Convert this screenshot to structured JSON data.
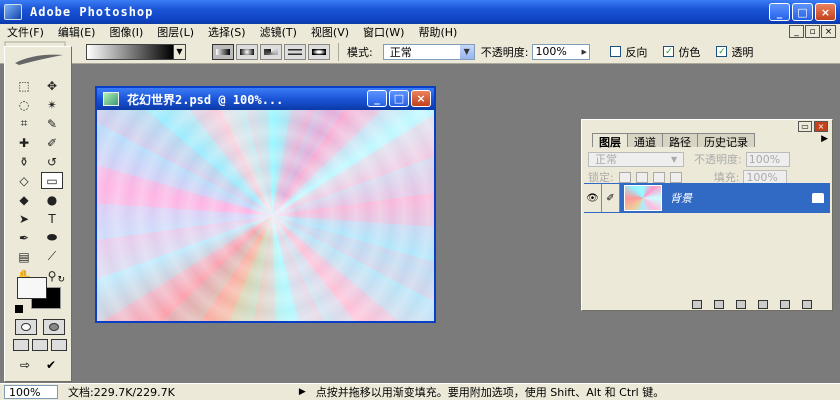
{
  "app": {
    "title": "Adobe Photoshop"
  },
  "window_buttons": {
    "minimize": "_",
    "maximize": "□",
    "close": "×"
  },
  "menu": [
    "文件(F)",
    "编辑(E)",
    "图像(I)",
    "图层(L)",
    "选择(S)",
    "滤镜(T)",
    "视图(V)",
    "窗口(W)",
    "帮助(H)"
  ],
  "options": {
    "mode_label": "模式:",
    "mode_value": "正常",
    "opacity_label": "不透明度:",
    "opacity_value": "100%",
    "reverse_label": "反向",
    "dither_label": "仿色",
    "transparency_label": "透明",
    "reverse_checked": false,
    "dither_checked": true,
    "transparency_checked": true
  },
  "document": {
    "title": "花幻世界2.psd @ 100%..."
  },
  "layers_panel": {
    "tabs": [
      "图层",
      "通道",
      "路径",
      "历史记录"
    ],
    "blend_mode": "正常",
    "opacity_label": "不透明度:",
    "opacity_value": "100%",
    "lock_label": "锁定:",
    "fill_label": "填充:",
    "fill_value": "100%",
    "layer_name": "背景"
  },
  "status": {
    "zoom": "100%",
    "doc_size": "文档:229.7K/229.7K",
    "hint": "点按并拖移以用渐变填充。要用附加选项，使用 Shift、Alt 和 Ctrl 键。"
  },
  "colors": {
    "foreground": "#f7f7f7",
    "background": "#000000",
    "titlebar": "#1a54d6"
  }
}
